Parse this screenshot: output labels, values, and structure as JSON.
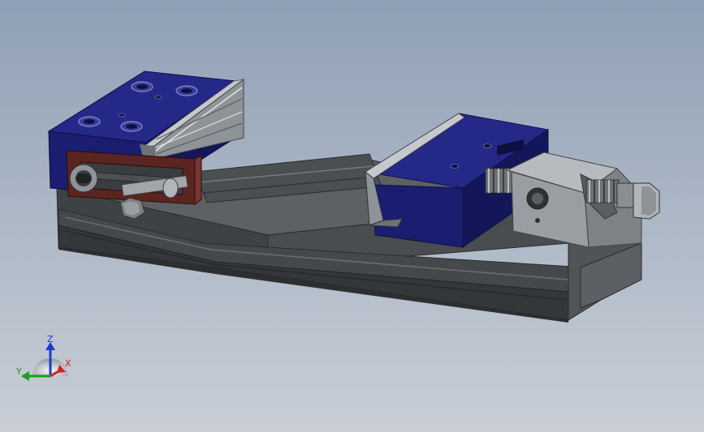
{
  "viewport": {
    "background_top": "#8fa0b6",
    "background_bottom": "#c9ced6"
  },
  "colors": {
    "body_dark": "#3a3d40",
    "body_mid": "#55595c",
    "body_light": "#6e7276",
    "body_edge": "#8a8e92",
    "jaw_blue": "#1c1f78",
    "jaw_blue_dark": "#14165a",
    "jaw_blue_light": "#2e3296",
    "plate_gray": "#8c9196",
    "plate_light": "#b9bdc1",
    "bracket_red": "#5c2622",
    "bracket_red_light": "#7a3530",
    "screw_gray": "#a4a8ac",
    "spring_gray": "#7b7f83"
  },
  "model": {
    "parts": [
      {
        "name": "vise-base"
      },
      {
        "name": "fixed-jaw"
      },
      {
        "name": "movable-jaw"
      },
      {
        "name": "end-block"
      },
      {
        "name": "clamp-bracket"
      },
      {
        "name": "lead-screw"
      }
    ]
  },
  "triad": {
    "x_label": "X",
    "y_label": "Y",
    "z_label": "Z",
    "x_color": "#d22020",
    "y_color": "#18a018",
    "z_color": "#1c3ad0"
  }
}
